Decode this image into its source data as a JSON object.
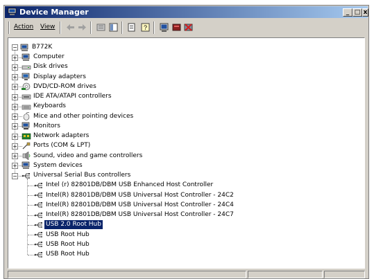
{
  "window": {
    "title": "Device Manager"
  },
  "menu": {
    "action": "Action",
    "view": "View"
  },
  "toolbar": {
    "icons": [
      "back-icon",
      "forward-icon",
      "properties-icon",
      "tree-icon",
      "print-icon",
      "help-icon",
      "scan-hardware-icon",
      "update-driver-icon",
      "uninstall-icon"
    ]
  },
  "tree": {
    "root": "B772K",
    "categories": [
      "Computer",
      "Disk drives",
      "Display adapters",
      "DVD/CD-ROM drives",
      "IDE ATA/ATAPI controllers",
      "Keyboards",
      "Mice and other pointing devices",
      "Monitors",
      "Network adapters",
      "Ports (COM & LPT)",
      "Sound, video and game controllers",
      "System devices",
      "Universal Serial Bus controllers"
    ],
    "usb_children": [
      "Intel (r) 82801DB/DBM USB Enhanced Host Controller",
      "Intel(R) 82801DB/DBM USB Universal Host Controller - 24C2",
      "Intel(R) 82801DB/DBM USB Universal Host Controller - 24C4",
      "Intel(R) 82801DB/DBM USB Universal Host Controller - 24C7",
      "USB 2.0 Root Hub",
      "USB Root Hub",
      "USB Root Hub",
      "USB Root Hub"
    ],
    "selected": "USB 2.0 Root Hub"
  },
  "colors": {
    "titlebar": "#0a246a",
    "selection": "#0a246a",
    "chrome": "#d4d0c8"
  }
}
